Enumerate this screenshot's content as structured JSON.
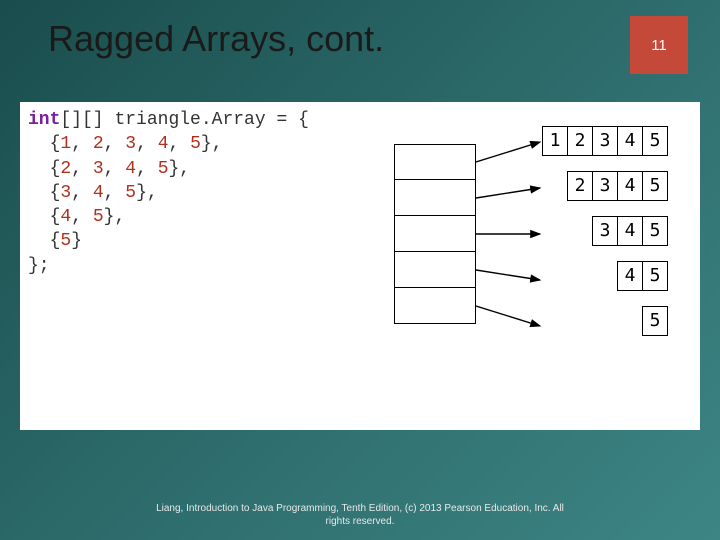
{
  "title": "Ragged Arrays, cont.",
  "page_number": "11",
  "code": {
    "keyword": "int",
    "brackets": "[][]",
    "ident": "triangle.Array",
    "assign": " = {",
    "rows": [
      [
        "1",
        "2",
        "3",
        "4",
        "5"
      ],
      [
        "2",
        "3",
        "4",
        "5"
      ],
      [
        "3",
        "4",
        "5"
      ],
      [
        "4",
        "5"
      ],
      [
        "5"
      ]
    ],
    "close": "};"
  },
  "data_rows": [
    [
      "1",
      "2",
      "3",
      "4",
      "5"
    ],
    [
      "2",
      "3",
      "4",
      "5"
    ],
    [
      "3",
      "4",
      "5"
    ],
    [
      "4",
      "5"
    ],
    [
      "5"
    ]
  ],
  "footer_line1": "Liang, Introduction to Java Programming, Tenth Edition, (c) 2013 Pearson Education, Inc. All",
  "footer_line2": "rights reserved."
}
